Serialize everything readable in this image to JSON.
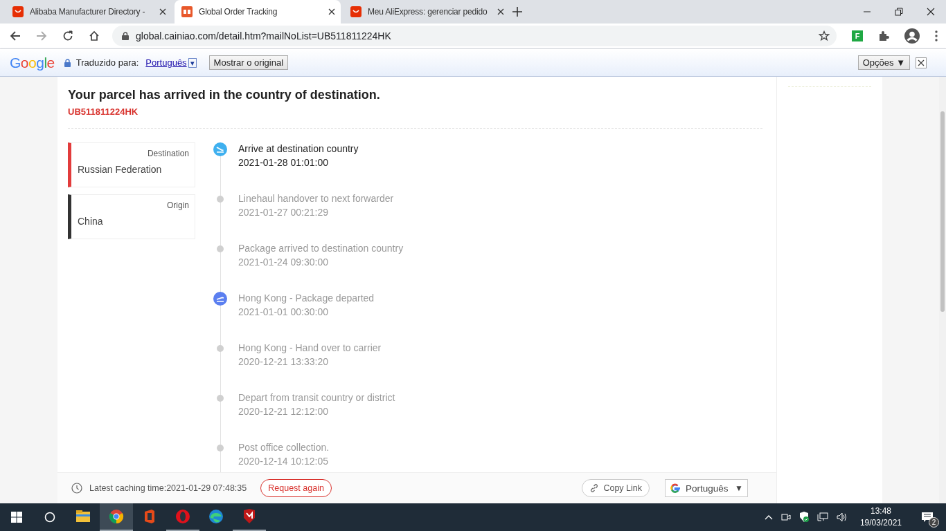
{
  "browser": {
    "tabs": [
      {
        "title": "Alibaba Manufacturer Directory -",
        "kind": "bag",
        "selected": false
      },
      {
        "title": "Global Order Tracking",
        "kind": "logo",
        "selected": true
      },
      {
        "title": "Meu AliExpress: gerenciar pedido",
        "kind": "bag",
        "selected": false
      }
    ],
    "address": "global.cainiao.com/detail.htm?mailNoList=UB511811224HK",
    "extension_label": "F"
  },
  "translate_bar": {
    "logo": "Google",
    "label": "Traduzido para:",
    "language": "Português",
    "language_caret": "▾",
    "show_original": "Mostrar o original",
    "options": "Opções ▼"
  },
  "tracking": {
    "status": "Your parcel has arrived in the country of destination.",
    "number": "UB511811224HK",
    "locations": [
      {
        "label": "Destination",
        "value": "Russian Federation",
        "color": "#e23c3c"
      },
      {
        "label": "Origin",
        "value": "China",
        "color": "#333333"
      }
    ],
    "events": [
      {
        "kind": "arrival",
        "current": true,
        "title": "Arrive at destination country",
        "time": "2021-01-28 01:01:00"
      },
      {
        "kind": "dot",
        "current": false,
        "title": "Linehaul handover to next forwarder",
        "time": "2021-01-27 00:21:29"
      },
      {
        "kind": "dot",
        "current": false,
        "title": "Package arrived to destination country",
        "time": "2021-01-24 09:30:00"
      },
      {
        "kind": "departure",
        "current": false,
        "title": "Hong Kong - Package departed",
        "time": "2021-01-01 00:30:00"
      },
      {
        "kind": "dot",
        "current": false,
        "title": "Hong Kong - Hand over to carrier",
        "time": "2020-12-21 13:33:20"
      },
      {
        "kind": "dot",
        "current": false,
        "title": "Depart from transit country or district",
        "time": "2020-12-21 12:12:00"
      },
      {
        "kind": "dot",
        "current": false,
        "title": "Post office collection.",
        "time": "2020-12-14 10:12:05"
      }
    ]
  },
  "footer": {
    "caching_time": "Latest caching time:2021-01-29 07:48:35",
    "request_again": "Request again",
    "copy_link": "Copy Link",
    "language": "Português",
    "language_caret": "▼"
  },
  "taskbar": {
    "apps": [
      {
        "kind": "explorer",
        "running": false,
        "selected": false
      },
      {
        "kind": "chrome",
        "running": true,
        "selected": true
      },
      {
        "kind": "office",
        "running": false,
        "selected": false
      },
      {
        "kind": "opera",
        "running": true,
        "selected": false
      },
      {
        "kind": "edge",
        "running": false,
        "selected": false
      },
      {
        "kind": "mcafee",
        "running": true,
        "selected": false
      }
    ],
    "time": "13:48",
    "date": "19/03/2021",
    "notifications": "2"
  }
}
